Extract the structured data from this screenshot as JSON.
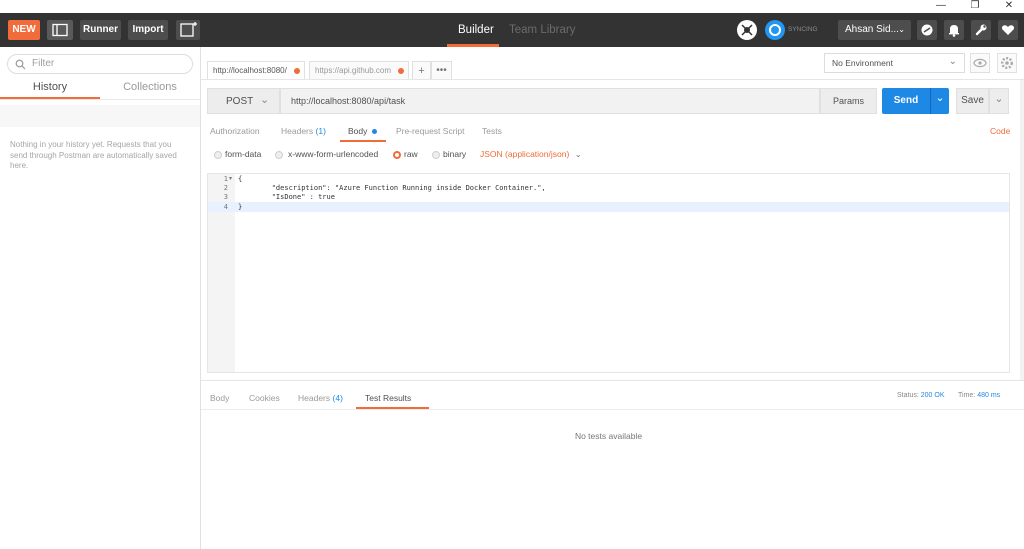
{
  "window": {
    "minimize": "—",
    "maximize": "❐",
    "close": "✕"
  },
  "toolbar": {
    "new_label": "NEW",
    "runner_label": "Runner",
    "import_label": "Import",
    "mode_builder": "Builder",
    "mode_team_library": "Team Library",
    "sync_label": "SYNCING",
    "user_name": "Ahsan Sid...",
    "colors": {
      "bg": "#333333",
      "new": "#f26b3a",
      "accent": "#2196f3"
    },
    "icons": [
      "sidebar-toggle-icon",
      "new-window-icon",
      "interceptor-icon",
      "sync-icon",
      "chevron-down-icon",
      "satellite-icon",
      "bell-icon",
      "wrench-icon",
      "heart-icon"
    ]
  },
  "sidebar": {
    "search_placeholder": "Filter",
    "tabs": [
      "History",
      "Collections"
    ],
    "empty_message": "Nothing in your history yet. Requests that you send through Postman are automatically saved here."
  },
  "request_tabs": [
    {
      "label": "http://localhost:8080/"
    },
    {
      "label": "https://api.github.com"
    }
  ],
  "environment": {
    "selected": "No Environment"
  },
  "request": {
    "method": "POST",
    "url": "http://localhost:8080/api/task",
    "params_label": "Params",
    "send_label": "Send",
    "save_label": "Save"
  },
  "request_subtabs": {
    "authorization": "Authorization",
    "headers": "Headers",
    "headers_count": "(1)",
    "body": "Body",
    "prerequest": "Pre-request Script",
    "tests": "Tests",
    "code": "Code"
  },
  "body_modes": {
    "form_data": "form-data",
    "urlencoded": "x-www-form-urlencoded",
    "raw": "raw",
    "binary": "binary",
    "content_type": "JSON (application/json)"
  },
  "editor": {
    "line_numbers": [
      "1",
      "2",
      "3",
      "4"
    ],
    "lines": [
      "{",
      "        \"description\": \"Azure Function Running inside Docker Container.\",",
      "        \"IsDone\" : true",
      "}"
    ]
  },
  "response": {
    "tabs": {
      "body": "Body",
      "cookies": "Cookies",
      "headers": "Headers",
      "headers_count": "(4)",
      "test_results": "Test Results"
    },
    "status_label": "Status:",
    "status_value": "200 OK",
    "time_label": "Time:",
    "time_value": "480 ms",
    "empty_message": "No tests available"
  }
}
